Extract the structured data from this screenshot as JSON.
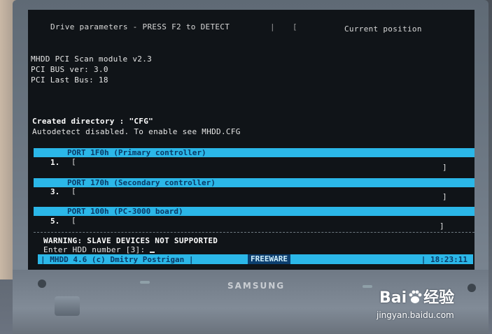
{
  "header": {
    "left_title": "Drive parameters - PRESS F2 to DETECT",
    "separator_1": "|",
    "separator_2": "[",
    "right_title": "Current position"
  },
  "log_lines": [
    "MHDD PCI Scan module v2.3",
    "PCI BUS ver: 3.0",
    "PCI Last Bus: 18",
    "Created directory : \"CFG\"",
    "Autodetect disabled. To enable see MHDD.CFG"
  ],
  "ports": [
    {
      "label": "PORT 1F0h (Primary controller)",
      "slot": "1.",
      "open": "[",
      "close": "]"
    },
    {
      "label": "PORT 170h (Secondary controller)",
      "slot": "3.",
      "open": "[",
      "close": "]"
    },
    {
      "label": "PORT 100h (PC-3000 board)",
      "slot": "5.",
      "open": "[",
      "close": "]"
    }
  ],
  "warning": "WARNING: SLAVE DEVICES NOT SUPPORTED",
  "prompt": "Enter HDD number [3]: ",
  "status_bar": {
    "app": "| MHDD 4.6 (c) Dmitry Postrigan |",
    "license": "FREEWARE",
    "time": "| 18:23:11"
  },
  "hardware": {
    "brand": "SAMSUNG"
  },
  "watermark": {
    "logo_left": "Bai",
    "logo_right": "经验",
    "url": "jingyan.baidu.com"
  },
  "colors": {
    "screen_bg": "#101418",
    "bar": "#2bb7e8",
    "bar_text": "#0b3a66"
  }
}
